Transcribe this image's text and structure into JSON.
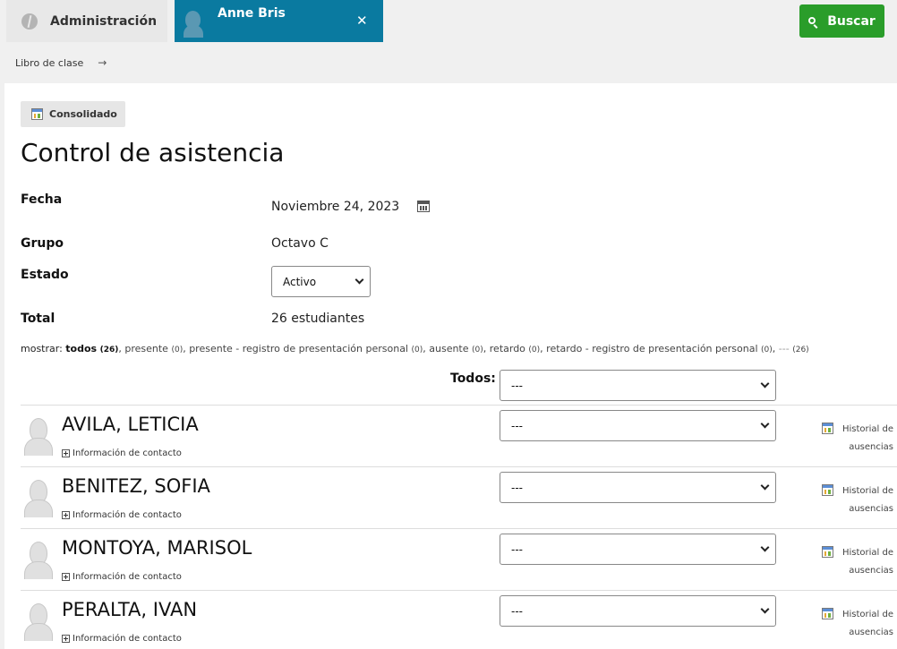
{
  "header": {
    "admin_tab": "Administración",
    "user_tab": "Anne Bris",
    "close_label": "✕",
    "search_label": "Buscar"
  },
  "breadcrumb": {
    "item": "Libro de clase",
    "arrow": "→"
  },
  "main": {
    "consolidado_label": "Consolidado",
    "title": "Control de asistencia",
    "fields": {
      "fecha_label": "Fecha",
      "fecha_value": "Noviembre 24, 2023",
      "grupo_label": "Grupo",
      "grupo_value": "Octavo C",
      "estado_label": "Estado",
      "estado_value": "Activo",
      "total_label": "Total",
      "total_value": "26 estudiantes"
    },
    "filters": {
      "label": "mostrar:",
      "items": [
        {
          "text": "todos",
          "count": "(26)"
        },
        {
          "text": "presente",
          "count": "(0)"
        },
        {
          "text": "presente - registro de presentación personal",
          "count": "(0)"
        },
        {
          "text": "ausente",
          "count": "(0)"
        },
        {
          "text": "retardo",
          "count": "(0)"
        },
        {
          "text": "retardo - registro de presentación personal",
          "count": "(0)"
        },
        {
          "text": "---",
          "count": "(26)"
        }
      ]
    },
    "todos_label": "Todos:",
    "todos_value": "---",
    "students": [
      {
        "name": "AVILA, LETICIA",
        "contact": "Información de contacto",
        "status": "---",
        "history_1": "Historial de",
        "history_2": "ausencias"
      },
      {
        "name": "BENITEZ, SOFIA",
        "contact": "Información de contacto",
        "status": "---",
        "history_1": "Historial de",
        "history_2": "ausencias"
      },
      {
        "name": "MONTOYA, MARISOL",
        "contact": "Información de contacto",
        "status": "---",
        "history_1": "Historial de",
        "history_2": "ausencias"
      },
      {
        "name": "PERALTA, IVAN",
        "contact": "Información de contacto",
        "status": "---",
        "history_1": "Historial de",
        "history_2": "ausencias"
      }
    ]
  },
  "colors": {
    "user_tab_bg": "#0a7aa0",
    "search_button_bg": "#2a9d2a",
    "page_bg": "#f0f0f0"
  },
  "icons": [
    "logo-icon",
    "user-avatar-icon",
    "close-icon",
    "search-icon",
    "arrow-right-icon",
    "calendar-icon",
    "chevron-down-icon",
    "expand-plus-icon",
    "student-avatar-icon"
  ]
}
